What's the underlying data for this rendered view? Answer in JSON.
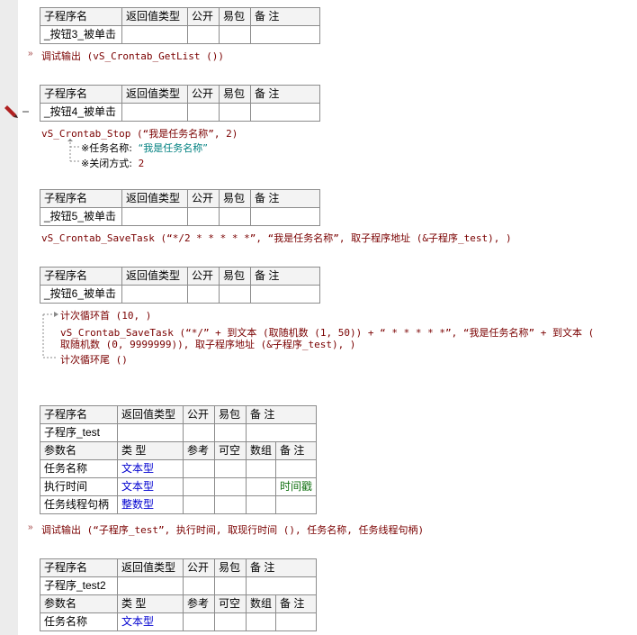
{
  "header_labels": [
    "子程序名",
    "返回值类型",
    "公开",
    "易包",
    "备 注"
  ],
  "param_header_labels": [
    "参数名",
    "类 型",
    "参考",
    "可空",
    "数组",
    "备 注"
  ],
  "block1": {
    "sub_name": "_按钮3_被单击",
    "code": "调试输出 (vS_Crontab_GetList ())"
  },
  "block2": {
    "sub_name": "_按钮4_被单击",
    "code": "vS_Crontab_Stop (“我是任务名称”, 2)",
    "param1_label": "※任务名称:",
    "param1_value": "“我是任务名称”",
    "param2_label": "※关闭方式:",
    "param2_value": "2"
  },
  "block3": {
    "sub_name": "_按钮5_被单击",
    "code": "vS_Crontab_SaveTask (“*/2 * * * * *”, “我是任务名称”, 取子程序地址 (&子程序_test), )"
  },
  "block4": {
    "sub_name": "_按钮6_被单击",
    "loop_start": "计次循环首 (10, )",
    "code_line1": "vS_Crontab_SaveTask (“*/” + 到文本 (取随机数 (1, 50)) + “ * * * * *”, “我是任务名称” + 到文本 (",
    "code_line2": "取随机数 (0, 9999999)), 取子程序地址 (&子程序_test), )",
    "loop_end": "计次循环尾 ()"
  },
  "block5": {
    "sub_name": "子程序_test",
    "params": [
      {
        "name": "任务名称",
        "type": "文本型",
        "note": ""
      },
      {
        "name": "执行时间",
        "type": "文本型",
        "note": "时间戳"
      },
      {
        "name": "任务线程句柄",
        "type": "整数型",
        "note": ""
      }
    ],
    "code": "调试输出 (“子程序_test”, 执行时间, 取现行时间 (), 任务名称, 任务线程句柄)"
  },
  "block6": {
    "sub_name": "子程序_test2",
    "params": [
      {
        "name": "任务名称",
        "type": "文本型",
        "note": ""
      }
    ]
  },
  "colors": {
    "keyword": "#7a0000",
    "type": "#0000d0",
    "string": "#008080",
    "note": "#107010"
  }
}
